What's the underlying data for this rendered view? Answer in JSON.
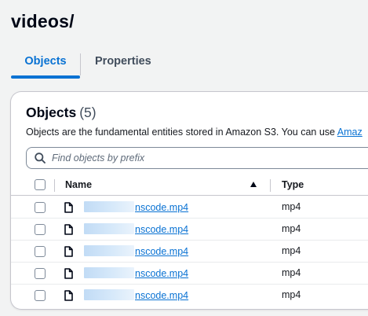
{
  "header": {
    "title": "videos/"
  },
  "tabs": [
    {
      "label": "Objects",
      "active": true
    },
    {
      "label": "Properties",
      "active": false
    }
  ],
  "objects_panel": {
    "title": "Objects",
    "count": "(5)",
    "description_prefix": "Objects are the fundamental entities stored in Amazon S3. You can use ",
    "description_link": "Amaz",
    "search_placeholder": "Find objects by prefix"
  },
  "table": {
    "columns": {
      "name": "Name",
      "type": "Type"
    },
    "sort": "ascending",
    "rows": [
      {
        "name_visible": "nscode.mp4",
        "type": "mp4"
      },
      {
        "name_visible": "nscode.mp4",
        "type": "mp4"
      },
      {
        "name_visible": "nscode.mp4",
        "type": "mp4"
      },
      {
        "name_visible": "nscode.mp4",
        "type": "mp4"
      },
      {
        "name_visible": "nscode.mp4",
        "type": "mp4"
      }
    ]
  },
  "colors": {
    "accent": "#0972d3",
    "text": "#16191f",
    "border": "#c6c6cd"
  },
  "icons": {
    "search": "search-icon",
    "file": "file-icon",
    "sort": "sort-ascending-icon"
  }
}
